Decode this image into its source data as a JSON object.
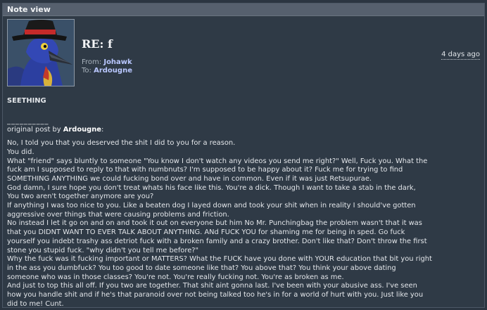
{
  "header": {
    "title": "Note view"
  },
  "note": {
    "subject": "RE: f",
    "from_label": "From:",
    "from_name": "Johawk",
    "to_label": "To:",
    "to_name": "Ardougne",
    "date": "4 days ago"
  },
  "content": {
    "heading": "SEETHING",
    "separator": "__________",
    "quote_prefix": "original post by ",
    "quote_author": "Ardougne",
    "quote_suffix": ":",
    "lines": [
      "No, I told you that you deserved the shit I did to you for a reason.",
      "You did.",
      "What \"friend\" says bluntly to someone \"You know I don't watch any videos you send me right?\" Well, Fuck you. What the",
      "fuck am I supposed to reply to that with numbnuts? I'm supposed to be happy about it? Fuck me for trying to find",
      "SOMETHING ANYTHING we could fucking bond over and have in common. Even if it was just Retsupurae.",
      "God damn, I sure hope you don't treat whats his face like this. You're a dick. Though I want to take a stab in the dark,",
      "You two aren't together anymore are you?",
      "If anything I was too nice to you. Like a beaten dog I layed down and took your shit when in reality I should've gotten",
      "aggressive over things that were causing problems and friction.",
      "No instead I let it go on and on and took it out on everyone but him No Mr. Punchingbag the problem wasn't that it was",
      "that you DIDNT WANT TO EVER TALK ABOUT ANYTHING. ANd FUCK YOU for shaming me for being in sped. Go fuck",
      "yourself you indebt trashy ass detriot fuck with a broken family and a crazy brother. Don't like that? Don't throw the first",
      "stone you stupid fuck. \"why didn't you tell me before?\"",
      "Why the fuck was it fucking important or MATTERS? What the FUCK have you done with YOUR education that bit you right",
      "in the ass you dumbfuck? You too good to date someone like that? You above that? You think your above dating",
      "someone who was in those classes? You're not. You're really fucking not. You're as broken as me.",
      "And just to top this all off. If you two are together. That shit aint gonna last. I've been with your abusive ass. I've seen",
      "how you handle shit and if he's that paranoid over not being talked too he's in for a world of hurt with you. Just like you",
      "did to me! Cunt."
    ]
  }
}
